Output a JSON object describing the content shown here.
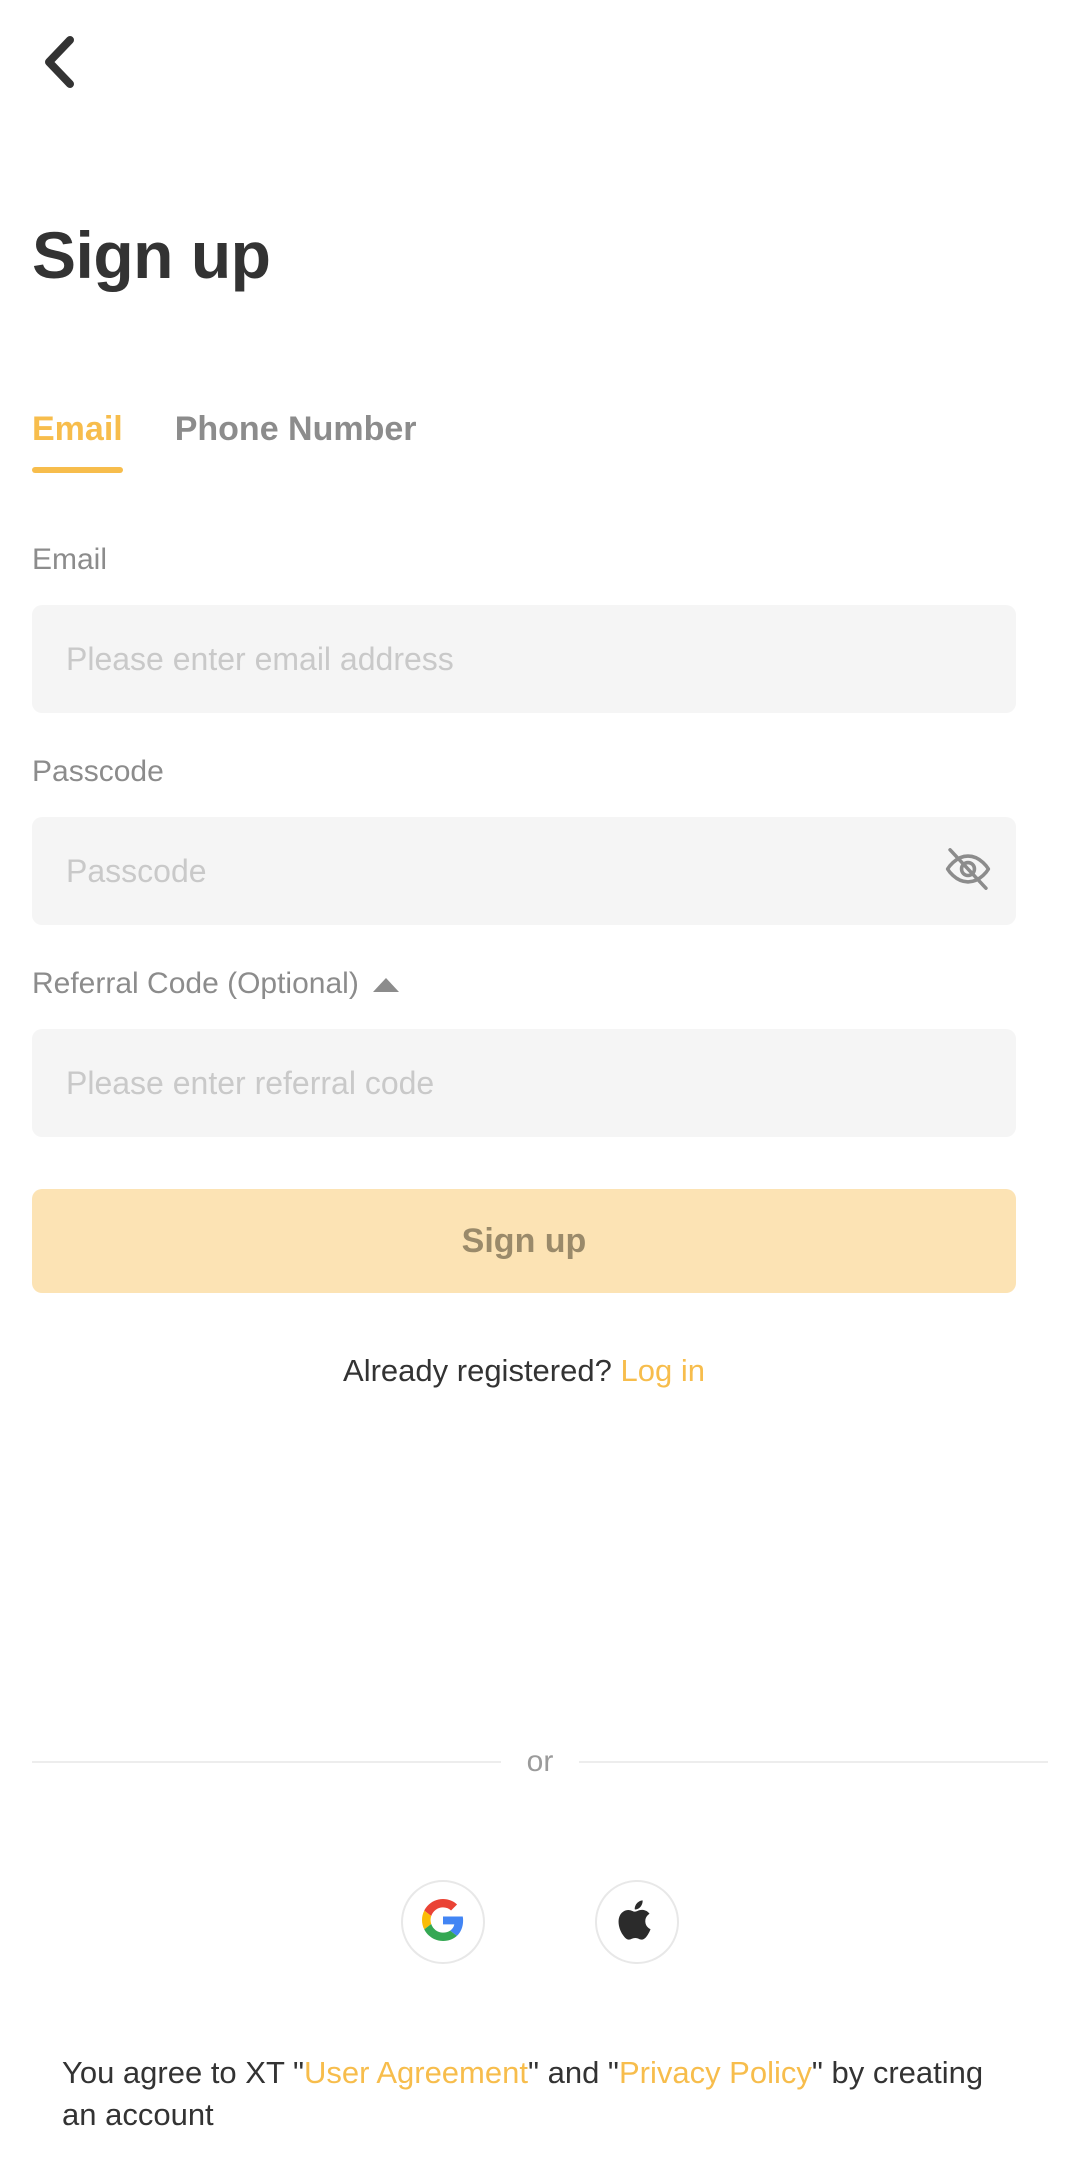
{
  "header": {
    "back_icon": "chevron-left-icon",
    "title": "Sign up"
  },
  "tabs": [
    {
      "label": "Email",
      "active": true
    },
    {
      "label": "Phone Number",
      "active": false
    }
  ],
  "form": {
    "email": {
      "label": "Email",
      "placeholder": "Please enter email address",
      "value": ""
    },
    "passcode": {
      "label": "Passcode",
      "placeholder": "Passcode",
      "value": "",
      "toggle_icon": "eye-off-icon"
    },
    "referral": {
      "label": "Referral Code (Optional)",
      "caret_icon": "caret-up-icon",
      "placeholder": "Please enter referral code",
      "value": ""
    },
    "submit_label": "Sign up"
  },
  "login_prompt": {
    "text": "Already registered?",
    "link": "Log in"
  },
  "divider": {
    "text": "or"
  },
  "social": [
    {
      "name": "google",
      "icon": "google-icon"
    },
    {
      "name": "apple",
      "icon": "apple-icon"
    }
  ],
  "terms": {
    "part1": "You agree to XT \"",
    "link1": "User Agreement",
    "part2": "\" and \"",
    "link2": "Privacy Policy",
    "part3": "\" by creating an account"
  },
  "colors": {
    "accent": "#f7bd4c",
    "accent_disabled": "#fce3b4",
    "accent_disabled_text": "#9a8a6a",
    "text_primary": "#333333",
    "text_secondary": "#8c8c8c",
    "placeholder": "#c9c9c9",
    "field_bg": "#f5f5f5"
  }
}
